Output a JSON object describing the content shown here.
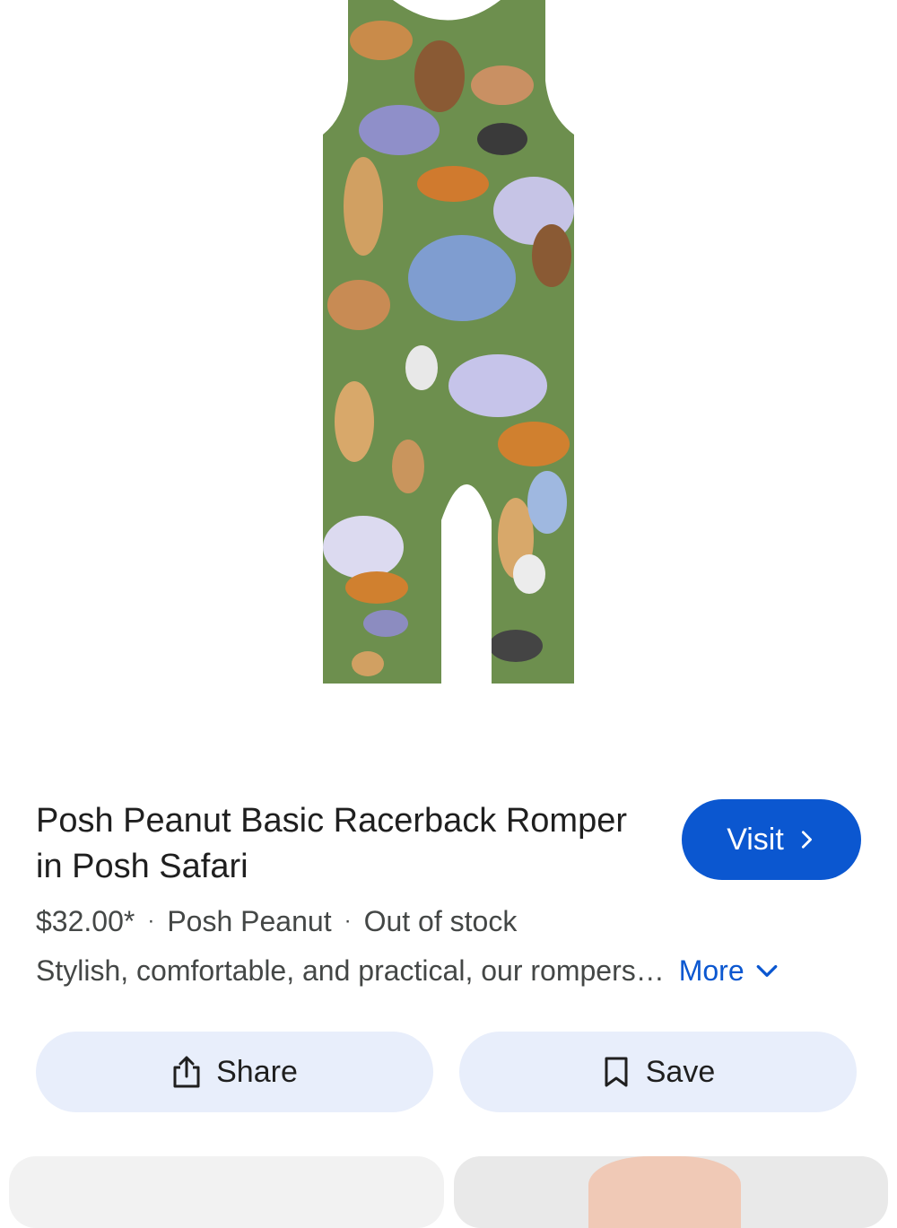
{
  "product": {
    "title": "Posh Peanut Basic Racerback Romper in Posh Safari",
    "price": "$32.00*",
    "separator": "·",
    "seller": "Posh Peanut",
    "stock_status": "Out of stock",
    "description": "Stylish, comfortable, and practical, our rompers…",
    "more_label": "More"
  },
  "actions": {
    "visit_label": "Visit",
    "share_label": "Share",
    "save_label": "Save"
  },
  "colors": {
    "accent": "#0b57d0",
    "pill_background": "#e8eefb",
    "romper_green": "#6d8f4e"
  },
  "icons": {
    "visit": "chevron-right-icon",
    "more": "chevron-down-icon",
    "share": "share-icon",
    "save": "bookmark-icon"
  }
}
